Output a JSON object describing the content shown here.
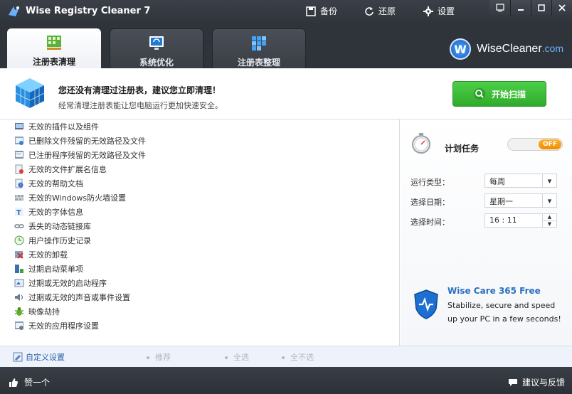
{
  "window": {
    "title": "Wise Registry Cleaner 7",
    "top_actions": [
      {
        "label": "备份",
        "icon": "save-icon"
      },
      {
        "label": "还原",
        "icon": "restore-icon"
      },
      {
        "label": "设置",
        "icon": "gear-icon"
      }
    ],
    "controls": [
      "menu-icon",
      "minimize-icon",
      "maximize-icon",
      "close-icon"
    ]
  },
  "tabs": [
    {
      "label": "注册表清理",
      "icon": "registry-clean-icon",
      "active": true
    },
    {
      "label": "系统优化",
      "icon": "system-optimize-icon",
      "active": false
    },
    {
      "label": "注册表整理",
      "icon": "registry-defrag-icon",
      "active": false
    }
  ],
  "brand": {
    "badge": "W",
    "name": "WiseCleaner",
    "tld": ".com"
  },
  "banner": {
    "title": "您还没有清理过注册表，建议您立即清理！",
    "subtitle": "经常清理注册表能让您电脑运行更加快速安全。",
    "scan_button": "开始扫描"
  },
  "items": [
    {
      "label": "无效的插件以及组件"
    },
    {
      "label": "已删除文件残留的无效路径及文件"
    },
    {
      "label": "已注册程序残留的无效路径及文件"
    },
    {
      "label": "无效的文件扩展名信息"
    },
    {
      "label": "无效的帮助文档"
    },
    {
      "label": "无效的Windows防火墙设置"
    },
    {
      "label": "无效的字体信息"
    },
    {
      "label": "丢失的动态链接库"
    },
    {
      "label": "用户操作历史记录"
    },
    {
      "label": "无效的卸载"
    },
    {
      "label": "过期启动菜单项"
    },
    {
      "label": "过期或无效的启动程序"
    },
    {
      "label": "过期或无效的声音或事件设置"
    },
    {
      "label": "映像劫持"
    },
    {
      "label": "无效的应用程序设置"
    }
  ],
  "schedule": {
    "title": "计划任务",
    "toggle": "OFF",
    "fields": [
      {
        "label": "运行类型：",
        "value": "每周"
      },
      {
        "label": "选择日期：",
        "value": "星期一"
      },
      {
        "label": "选择时间：",
        "value": "16 : 11"
      }
    ]
  },
  "promo": {
    "title": "Wise Care 365 Free",
    "line1": "Stabilize, secure and speed",
    "line2": "up your PC in a few seconds!"
  },
  "bottom": {
    "custom": "自定义设置",
    "recommend": "推荐",
    "select_all": "全选",
    "select_none": "全不选"
  },
  "status": {
    "like": "赞一个",
    "feedback": "建议与反馈"
  },
  "colors": {
    "accent_green": "#35b331",
    "link_blue": "#2a5ea8",
    "toggle_orange": "#f18b00",
    "frame_dark": "#2f333a"
  }
}
